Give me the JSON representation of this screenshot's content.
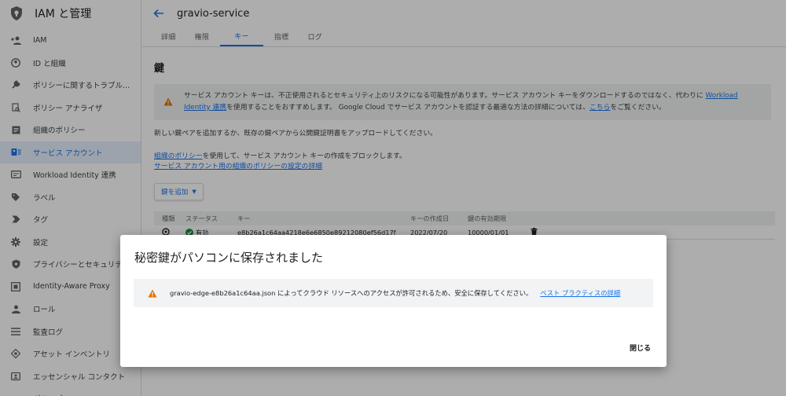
{
  "sidebar": {
    "title": "IAM と管理",
    "items": [
      {
        "label": "IAM",
        "icon": "person-add-icon"
      },
      {
        "label": "ID と組織",
        "icon": "account-circle-icon"
      },
      {
        "label": "ポリシーに関するトラブル...",
        "icon": "wrench-icon"
      },
      {
        "label": "ポリシー アナライザ",
        "icon": "policy-search-icon"
      },
      {
        "label": "組織のポリシー",
        "icon": "document-list-icon"
      },
      {
        "label": "サービス アカウント",
        "icon": "service-account-icon",
        "active": true
      },
      {
        "label": "Workload Identity 連携",
        "icon": "id-card-icon"
      },
      {
        "label": "ラベル",
        "icon": "label-icon"
      },
      {
        "label": "タグ",
        "icon": "tag-arrow-icon"
      },
      {
        "label": "設定",
        "icon": "gear-icon"
      },
      {
        "label": "プライバシーとセキュリティ",
        "icon": "shield-icon"
      },
      {
        "label": "Identity-Aware Proxy",
        "icon": "iap-icon"
      },
      {
        "label": "ロール",
        "icon": "roles-icon"
      },
      {
        "label": "監査ログ",
        "icon": "list-icon"
      },
      {
        "label": "アセット インベントリ",
        "icon": "diamond-icon"
      },
      {
        "label": "エッセンシャル コンタクト",
        "icon": "contacts-icon"
      },
      {
        "label": "グループ",
        "icon": "group-icon"
      }
    ]
  },
  "header": {
    "title": "gravio-service"
  },
  "tabs": [
    {
      "label": "詳細"
    },
    {
      "label": "権限"
    },
    {
      "label": "キー",
      "active": true
    },
    {
      "label": "指標"
    },
    {
      "label": "ログ"
    }
  ],
  "main": {
    "section_title": "鍵",
    "warning": {
      "text1": "サービス アカウント キーは、不正使用されるとセキュリティ上のリスクになる可能性があります。サービス アカウント キーをダウンロードするのではなく、代わりに ",
      "link1": "Workload Identity 連携",
      "text2": "を使用することをおすすめします。 Google Cloud でサービス アカウントを認証する最適な方法の詳細については、",
      "link2": "こちら",
      "text3": "をご覧ください。"
    },
    "intro": "新しい鍵ペアを追加するか、既存の鍵ペアから公開鍵証明書をアップロードしてください。",
    "policy_link": "組織のポリシー",
    "policy_text": "を使用して、サービス アカウント キーの作成をブロックします。",
    "policy_detail_link": "サービス アカウント用の組織のポリシーの設定の詳細",
    "add_key_label": "鍵を追加",
    "table": {
      "headers": {
        "type": "種類",
        "status": "ステータス",
        "key": "キー",
        "created": "キーの作成日",
        "expiry": "鍵の有効期限"
      },
      "row": {
        "status": "有効",
        "key": "e8b26a1c64aa4218e6e6850e89212080ef56d17f",
        "created": "2022/07/20",
        "expiry": "10000/01/01"
      }
    }
  },
  "dialog": {
    "title": "秘密鍵がパソコンに保存されました",
    "message": "gravio-edge-e8b26a1c64aa.json によってクラウド リソースへのアクセスが許可されるため、安全に保存してください。",
    "link": "ベスト プラクティスの詳細",
    "close_label": "閉じる"
  },
  "colors": {
    "accent": "#1a73e8",
    "warning": "#e37400",
    "success": "#1e8e3e"
  }
}
